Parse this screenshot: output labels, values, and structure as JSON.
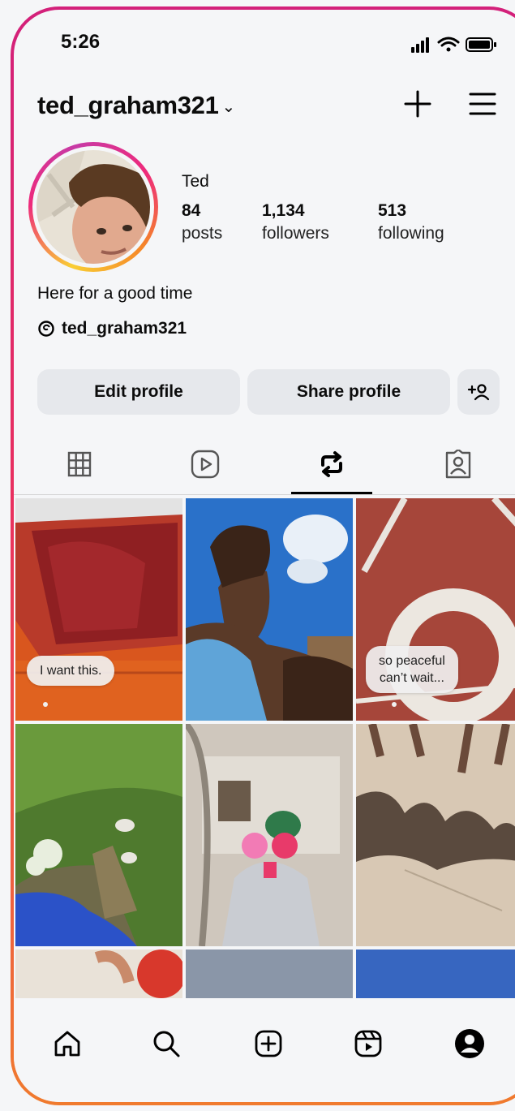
{
  "status_bar": {
    "time": "5:26"
  },
  "header": {
    "username": "ted_graham321",
    "chevron_icon": "chevron-down-icon",
    "create_icon": "plus-icon",
    "menu_icon": "hamburger-menu-icon"
  },
  "profile": {
    "display_name": "Ted",
    "stats": [
      {
        "count": "84",
        "label": "posts"
      },
      {
        "count": "1,134",
        "label": "followers"
      },
      {
        "count": "513",
        "label": "following"
      }
    ],
    "bio": "Here for a good time",
    "threads_handle": "ted_graham321"
  },
  "actions": {
    "edit_label": "Edit profile",
    "share_label": "Share profile",
    "discover_icon": "add-person-icon"
  },
  "tabs": [
    {
      "name": "posts",
      "icon": "grid-icon",
      "active": false
    },
    {
      "name": "reels",
      "icon": "reels-play-icon",
      "active": false
    },
    {
      "name": "reposts",
      "icon": "repost-icon",
      "active": true
    },
    {
      "name": "tagged",
      "icon": "tagged-person-icon",
      "active": false
    }
  ],
  "grid": {
    "notes": {
      "note_1": "I want this.",
      "note_2_line1": "so peaceful",
      "note_2_line2": "can’t wait..."
    }
  },
  "bottom_nav": [
    "home-icon",
    "search-icon",
    "create-icon",
    "reels-icon",
    "profile-icon"
  ],
  "colors": {
    "ring_start": "#d3207a",
    "ring_end": "#f07a2e",
    "button_bg": "#e6e8ec",
    "background": "#f5f6f8"
  }
}
